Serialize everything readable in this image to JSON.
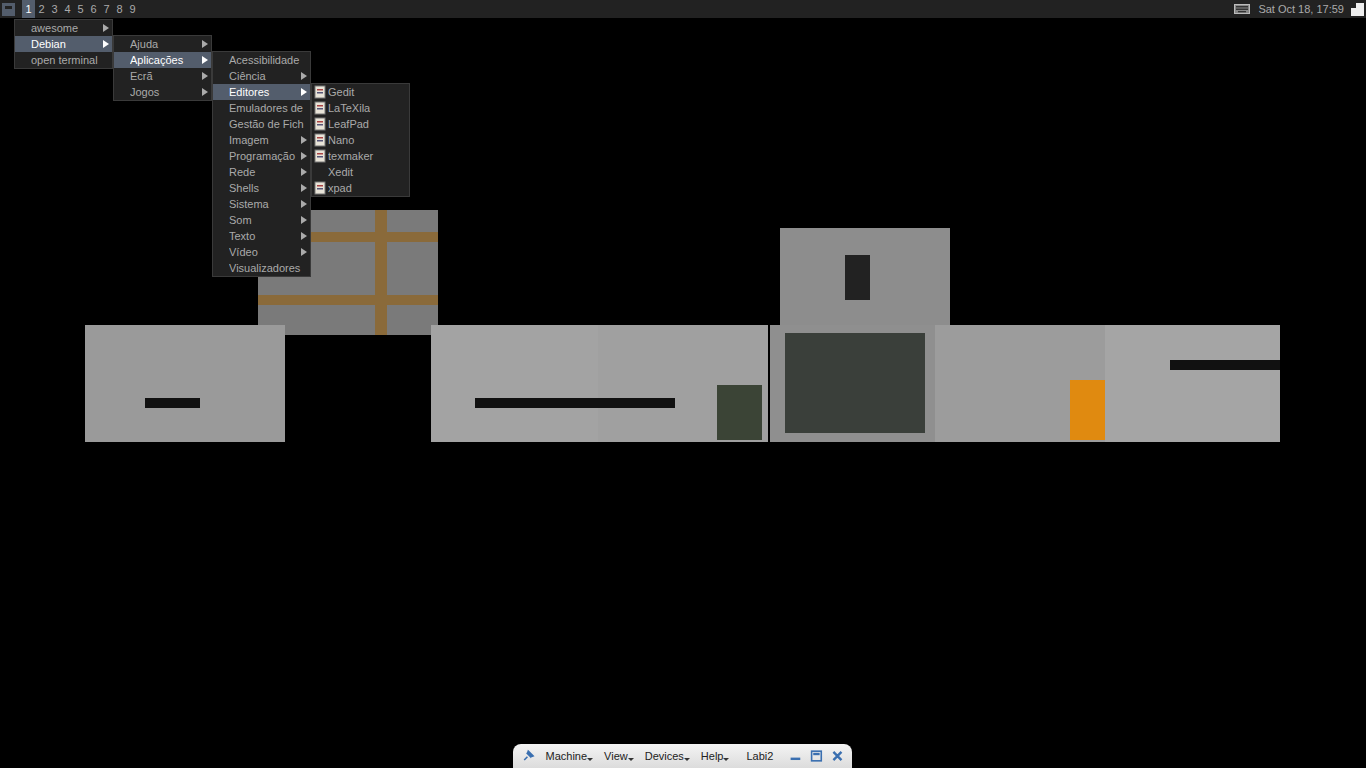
{
  "top_bar": {
    "tags": [
      {
        "label": "1",
        "selected": true
      },
      {
        "label": "2",
        "selected": false
      },
      {
        "label": "3",
        "selected": false
      },
      {
        "label": "4",
        "selected": false
      },
      {
        "label": "5",
        "selected": false
      },
      {
        "label": "6",
        "selected": false
      },
      {
        "label": "7",
        "selected": false
      },
      {
        "label": "8",
        "selected": false
      },
      {
        "label": "9",
        "selected": false
      }
    ],
    "clock": "Sat Oct 18, 17:59"
  },
  "menus": [
    {
      "items": [
        {
          "label": "awesome",
          "submenu": true,
          "selected": false,
          "icon": false
        },
        {
          "label": "Debian",
          "submenu": true,
          "selected": true,
          "icon": false
        },
        {
          "label": "open terminal",
          "submenu": false,
          "selected": false,
          "icon": false
        }
      ]
    },
    {
      "items": [
        {
          "label": "Ajuda",
          "submenu": true,
          "selected": false,
          "icon": false
        },
        {
          "label": "Aplicações",
          "submenu": true,
          "selected": true,
          "icon": false
        },
        {
          "label": "Ecrã",
          "submenu": true,
          "selected": false,
          "icon": false
        },
        {
          "label": "Jogos",
          "submenu": true,
          "selected": false,
          "icon": false
        }
      ]
    },
    {
      "items": [
        {
          "label": "Acessibilidade",
          "submenu": false,
          "selected": false,
          "icon": false
        },
        {
          "label": "Ciência",
          "submenu": true,
          "selected": false,
          "icon": false
        },
        {
          "label": "Editores",
          "submenu": true,
          "selected": true,
          "icon": false
        },
        {
          "label": "Emuladores de",
          "submenu": false,
          "selected": false,
          "icon": false
        },
        {
          "label": "Gestão de Fich",
          "submenu": false,
          "selected": false,
          "icon": false
        },
        {
          "label": "Imagem",
          "submenu": true,
          "selected": false,
          "icon": false
        },
        {
          "label": "Programação",
          "submenu": true,
          "selected": false,
          "icon": false
        },
        {
          "label": "Rede",
          "submenu": true,
          "selected": false,
          "icon": false
        },
        {
          "label": "Shells",
          "submenu": true,
          "selected": false,
          "icon": false
        },
        {
          "label": "Sistema",
          "submenu": true,
          "selected": false,
          "icon": false
        },
        {
          "label": "Som",
          "submenu": true,
          "selected": false,
          "icon": false
        },
        {
          "label": "Texto",
          "submenu": true,
          "selected": false,
          "icon": false
        },
        {
          "label": "Vídeo",
          "submenu": true,
          "selected": false,
          "icon": false
        },
        {
          "label": "Visualizadores",
          "submenu": false,
          "selected": false,
          "icon": false
        }
      ]
    },
    {
      "items": [
        {
          "label": "Gedit",
          "submenu": false,
          "selected": false,
          "icon": true
        },
        {
          "label": "LaTeXila",
          "submenu": false,
          "selected": false,
          "icon": true
        },
        {
          "label": "LeafPad",
          "submenu": false,
          "selected": false,
          "icon": true
        },
        {
          "label": "Nano",
          "submenu": false,
          "selected": false,
          "icon": true
        },
        {
          "label": "texmaker",
          "submenu": false,
          "selected": false,
          "icon": true
        },
        {
          "label": "Xedit",
          "submenu": false,
          "selected": false,
          "icon": false
        },
        {
          "label": "xpad",
          "submenu": false,
          "selected": false,
          "icon": true
        }
      ]
    }
  ],
  "vm_toolbar": {
    "menus": [
      "Machine",
      "View",
      "Devices",
      "Help"
    ],
    "machine_name": "Labi2"
  }
}
